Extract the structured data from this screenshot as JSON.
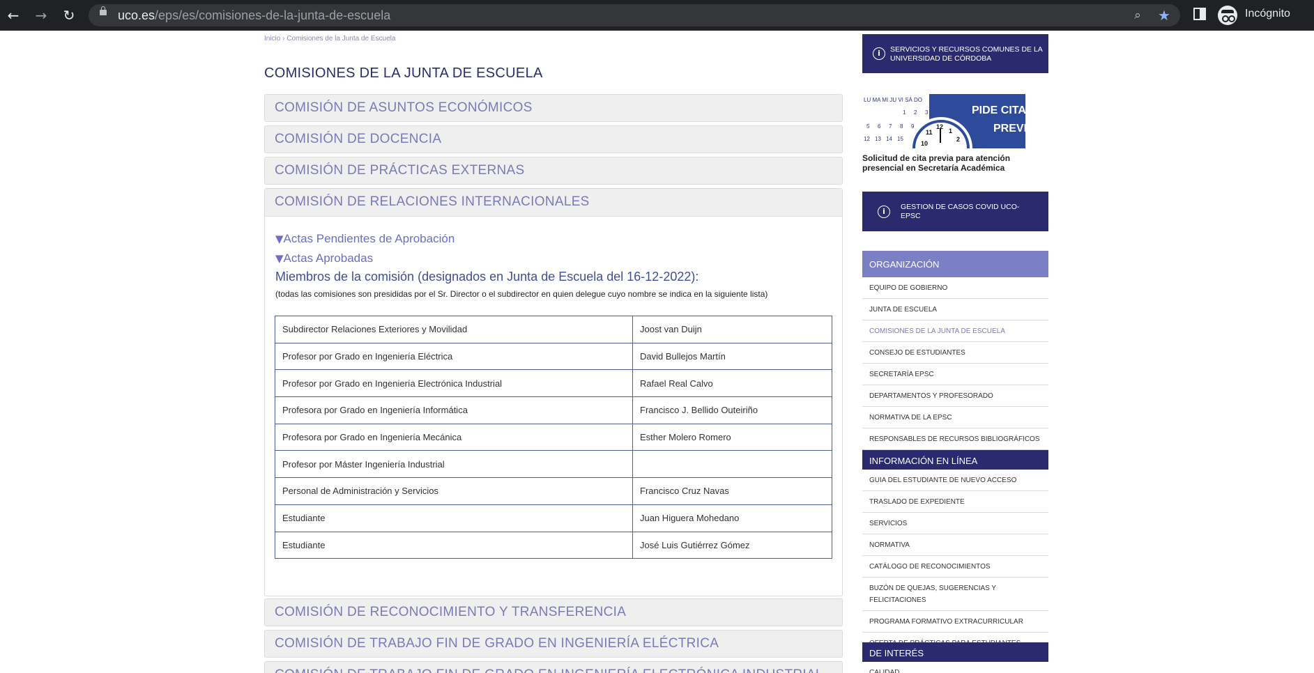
{
  "browser": {
    "url_host": "uco.es",
    "url_path": "/eps/es/comisiones-de-la-junta-de-escuela",
    "profile_label": "Incógnito",
    "icons": [
      "back-arrow-icon",
      "forward-arrow-icon",
      "reload-icon",
      "lock-icon",
      "zoom-icon",
      "bookmark-star-icon",
      "side-panel-icon",
      "incognito-icon"
    ]
  },
  "breadcrumb": {
    "home": "Inicio",
    "separator": "›",
    "current": "Comisiones de la Junta de Escuela"
  },
  "page_title": "COMISIONES DE LA JUNTA DE ESCUELA",
  "accordions_top": [
    "COMISIÓN DE ASUNTOS ECONÓMICOS",
    "COMISIÓN DE DOCENCIA",
    "COMISIÓN DE PRÁCTICAS EXTERNAS"
  ],
  "open_accordion": {
    "title": "COMISIÓN DE RELACIONES INTERNACIONALES",
    "triangle": "▼",
    "actas_pendientes": "Actas Pendientes de Aprobación",
    "actas_aprobadas": "Actas Aprobadas",
    "members_title": "Miembros de la comisión (designados en Junta de Escuela del 16-12-2022):",
    "members_note": "(todas las comisiones son presididas por el Sr. Director o el subdirector en quien delegue cuyo nombre se indica en la siguiente lista)",
    "members": [
      {
        "role": "Subdirector Relaciones Exteriores y Movilidad",
        "name": "Joost van Duijn"
      },
      {
        "role": "Profesor por Grado en Ingeniería Eléctrica",
        "name": "David Bullejos Martín"
      },
      {
        "role": "Profesor por Grado en Ingeniería Electrónica Industrial",
        "name": "Rafael Real Calvo"
      },
      {
        "role": "Profesora por Grado en Ingeniería Informática",
        "name": "Francisco J. Bellido Outeiriño"
      },
      {
        "role": "Profesora por Grado en Ingeniería Mecánica",
        "name": "Esther Molero Romero"
      },
      {
        "role": "Profesor por Máster Ingeniería Industrial",
        "name": ""
      },
      {
        "role": "Personal de Administración y Servicios",
        "name": "Francisco Cruz Navas"
      },
      {
        "role": "Estudiante",
        "name": "Juan Higuera Mohedano"
      },
      {
        "role": "Estudiante",
        "name": "José Luis Gutiérrez Gómez"
      }
    ]
  },
  "accordions_bottom": [
    "COMISIÓN DE RECONOCIMIENTO Y TRANSFERENCIA",
    "COMISIÓN DE TRABAJO FIN DE GRADO EN INGENIERÍA ELÉCTRICA",
    "COMISIÓN DE TRABAJO FIN DE GRADO EN INGENIERÍA ELECTRÓNICA INDUSTRIAL"
  ],
  "sidebar": {
    "banner_servicios": "SERVICIOS Y RECURSOS COMUNES DE LA UNIVERSIDAD DE CÓRDOBA",
    "cita": {
      "days_header": "LU MA MI JU VI SÁ DO",
      "logo_line1": "PIDE CITA",
      "logo_line2": "PREVIA",
      "caption": "Solicitud de cita previa para atención presencial en Secretaría Académica"
    },
    "banner_covid": "GESTION DE CASOS COVID UCO-EPSC",
    "organizacion": {
      "heading": "ORGANIZACIÓN",
      "color": "#7b80c4",
      "items": [
        "EQUIPO DE GOBIERNO",
        "JUNTA DE ESCUELA",
        "COMISIONES DE LA JUNTA DE ESCUELA",
        "CONSEJO DE ESTUDIANTES",
        "SECRETARÍA EPSC",
        "DEPARTAMENTOS Y PROFESORADO",
        "NORMATIVA DE LA EPSC",
        "RESPONSABLES DE RECURSOS BIBLIOGRÁFICOS"
      ]
    },
    "informacion": {
      "heading": "INFORMACIÓN EN LÍNEA",
      "color": "#2b2a6e",
      "items": [
        "GUIA DEL ESTUDIANTE DE NUEVO ACCESO",
        "TRASLADO DE EXPEDIENTE",
        "SERVICIOS",
        "NORMATIVA",
        "CATÁLOGO DE RECONOCIMIENTOS",
        "BUZÓN DE QUEJAS, SUGERENCIAS Y FELICITACIONES",
        "PROGRAMA FORMATIVO EXTRACURRICULAR",
        "OFERTA DE PRÁCTICAS PARA ESTUDIANTES"
      ]
    },
    "interes": {
      "heading": "DE INTERÉS",
      "items": [
        "CALIDAD"
      ]
    }
  }
}
